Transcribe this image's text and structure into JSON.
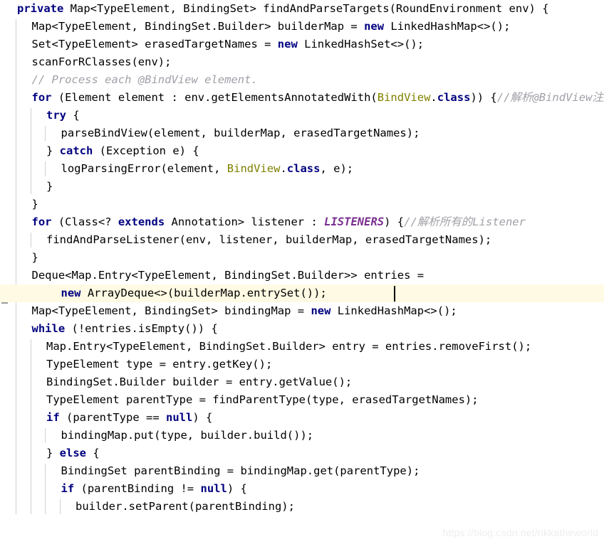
{
  "editor": {
    "language": "Java",
    "colors": {
      "background": "#ffffff",
      "foreground": "#000000",
      "keyword": "#000080",
      "comment": "#a0a0a8",
      "annotation": "#808000",
      "static_field": "#7a2f8f",
      "caret_line": "#fffae3",
      "indent_guide": "#d0d0d0",
      "caret": "#000000",
      "watermark": "#eeeeee"
    },
    "caret_line_index": 16,
    "watermark": "https://blog.csdn.net/rikkatheworld",
    "gutter": {
      "intention_bulb": "lightbulb-icon"
    }
  },
  "code_lines": [
    {
      "indent": 0,
      "tokens": [
        {
          "t": "kw",
          "v": "private"
        },
        {
          "t": "plain",
          "v": " Map<TypeElement, BindingSet> findAndParseTargets(RoundEnvironment env) {"
        }
      ]
    },
    {
      "indent": 1,
      "tokens": [
        {
          "t": "plain",
          "v": "Map<TypeElement, BindingSet.Builder> builderMap = "
        },
        {
          "t": "kw",
          "v": "new"
        },
        {
          "t": "plain",
          "v": " LinkedHashMap<>();"
        }
      ]
    },
    {
      "indent": 1,
      "tokens": [
        {
          "t": "plain",
          "v": "Set<TypeElement> erasedTargetNames = "
        },
        {
          "t": "kw",
          "v": "new"
        },
        {
          "t": "plain",
          "v": " LinkedHashSet<>();"
        }
      ]
    },
    {
      "indent": 1,
      "tokens": [
        {
          "t": "plain",
          "v": "scanForRClasses(env);"
        }
      ]
    },
    {
      "indent": 1,
      "tokens": [
        {
          "t": "cmt",
          "v": "// Process each @BindView element."
        }
      ]
    },
    {
      "indent": 1,
      "tokens": [
        {
          "t": "kw",
          "v": "for"
        },
        {
          "t": "plain",
          "v": " (Element element : env.getElementsAnnotatedWith("
        },
        {
          "t": "ann",
          "v": "BindView"
        },
        {
          "t": "plain",
          "v": "."
        },
        {
          "t": "kw",
          "v": "class"
        },
        {
          "t": "plain",
          "v": ")) {"
        },
        {
          "t": "cmt",
          "v": "//解析@BindView注解"
        }
      ]
    },
    {
      "indent": 2,
      "tokens": [
        {
          "t": "kw",
          "v": "try"
        },
        {
          "t": "plain",
          "v": " {"
        }
      ]
    },
    {
      "indent": 3,
      "tokens": [
        {
          "t": "plain",
          "v": "parseBindView(element, builderMap, erasedTargetNames);"
        }
      ]
    },
    {
      "indent": 2,
      "tokens": [
        {
          "t": "plain",
          "v": "} "
        },
        {
          "t": "kw",
          "v": "catch"
        },
        {
          "t": "plain",
          "v": " (Exception e) {"
        }
      ]
    },
    {
      "indent": 3,
      "tokens": [
        {
          "t": "plain",
          "v": "logParsingError(element, "
        },
        {
          "t": "ann",
          "v": "BindView"
        },
        {
          "t": "plain",
          "v": "."
        },
        {
          "t": "kw",
          "v": "class"
        },
        {
          "t": "plain",
          "v": ", e);"
        }
      ]
    },
    {
      "indent": 2,
      "tokens": [
        {
          "t": "plain",
          "v": "}"
        }
      ]
    },
    {
      "indent": 1,
      "tokens": [
        {
          "t": "plain",
          "v": "}"
        }
      ]
    },
    {
      "indent": 1,
      "tokens": [
        {
          "t": "kw",
          "v": "for"
        },
        {
          "t": "plain",
          "v": " (Class<? "
        },
        {
          "t": "kw",
          "v": "extends"
        },
        {
          "t": "plain",
          "v": " Annotation> listener : "
        },
        {
          "t": "stat",
          "v": "LISTENERS"
        },
        {
          "t": "plain",
          "v": ") {"
        },
        {
          "t": "cmt",
          "v": "//解析所有的Listener"
        }
      ]
    },
    {
      "indent": 2,
      "tokens": [
        {
          "t": "plain",
          "v": "findAndParseListener(env, listener, builderMap, erasedTargetNames);"
        }
      ]
    },
    {
      "indent": 1,
      "tokens": [
        {
          "t": "plain",
          "v": "}"
        }
      ]
    },
    {
      "indent": 1,
      "tokens": [
        {
          "t": "plain",
          "v": "Deque<Map.Entry<TypeElement, BindingSet.Builder>> entries ="
        }
      ]
    },
    {
      "indent": 3,
      "tokens": [
        {
          "t": "kw",
          "v": "new"
        },
        {
          "t": "plain",
          "v": " ArrayDeque<>(builderMap.entrySet());"
        }
      ]
    },
    {
      "indent": 1,
      "tokens": [
        {
          "t": "plain",
          "v": "Map<TypeElement, BindingSet> bindingMap = "
        },
        {
          "t": "kw",
          "v": "new"
        },
        {
          "t": "plain",
          "v": " LinkedHashMap<>();"
        }
      ]
    },
    {
      "indent": 1,
      "tokens": [
        {
          "t": "kw",
          "v": "while"
        },
        {
          "t": "plain",
          "v": " (!entries.isEmpty()) {"
        }
      ]
    },
    {
      "indent": 2,
      "tokens": [
        {
          "t": "plain",
          "v": "Map.Entry<TypeElement, BindingSet.Builder> entry = entries.removeFirst();"
        }
      ]
    },
    {
      "indent": 2,
      "tokens": [
        {
          "t": "plain",
          "v": "TypeElement type = entry.getKey();"
        }
      ]
    },
    {
      "indent": 2,
      "tokens": [
        {
          "t": "plain",
          "v": "BindingSet.Builder builder = entry.getValue();"
        }
      ]
    },
    {
      "indent": 2,
      "tokens": [
        {
          "t": "plain",
          "v": "TypeElement parentType = findParentType(type, erasedTargetNames);"
        }
      ]
    },
    {
      "indent": 2,
      "tokens": [
        {
          "t": "kw",
          "v": "if"
        },
        {
          "t": "plain",
          "v": " (parentType == "
        },
        {
          "t": "kw",
          "v": "null"
        },
        {
          "t": "plain",
          "v": ") {"
        }
      ]
    },
    {
      "indent": 3,
      "tokens": [
        {
          "t": "plain",
          "v": "bindingMap.put(type, builder.build());"
        }
      ]
    },
    {
      "indent": 2,
      "tokens": [
        {
          "t": "plain",
          "v": "} "
        },
        {
          "t": "kw",
          "v": "else"
        },
        {
          "t": "plain",
          "v": " {"
        }
      ]
    },
    {
      "indent": 3,
      "tokens": [
        {
          "t": "plain",
          "v": "BindingSet parentBinding = bindingMap.get(parentType);"
        }
      ]
    },
    {
      "indent": 3,
      "tokens": [
        {
          "t": "kw",
          "v": "if"
        },
        {
          "t": "plain",
          "v": " (parentBinding != "
        },
        {
          "t": "kw",
          "v": "null"
        },
        {
          "t": "plain",
          "v": ") {"
        }
      ]
    },
    {
      "indent": 4,
      "tokens": [
        {
          "t": "plain",
          "v": "builder.setParent(parentBinding);"
        }
      ]
    }
  ]
}
